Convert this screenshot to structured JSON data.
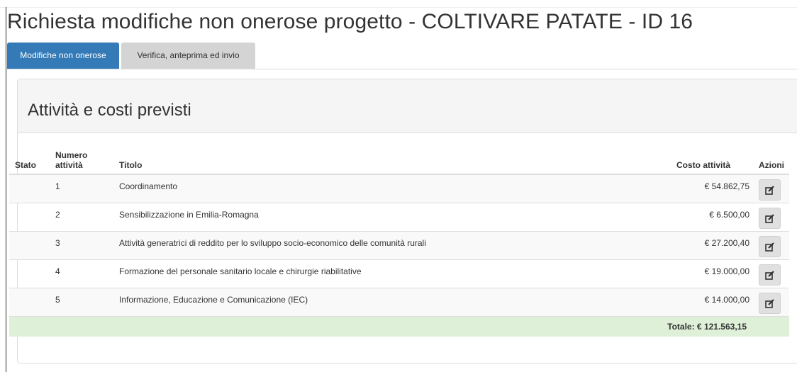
{
  "page": {
    "title": "Richiesta modifiche non onerose progetto - COLTIVARE PATATE - ID 16"
  },
  "tabs": [
    {
      "label": "Modifiche non onerose",
      "active": true
    },
    {
      "label": "Verifica, anteprima ed invio",
      "active": false
    }
  ],
  "panel": {
    "title": "Attività e costi previsti"
  },
  "table": {
    "headers": {
      "stato": "Stato",
      "numero": "Numero attività",
      "titolo": "Titolo",
      "costo": "Costo attività",
      "azioni": "Azioni"
    },
    "rows": [
      {
        "stato": "",
        "numero": "1",
        "titolo": "Coordinamento",
        "costo": "€ 54.862,75",
        "action_icon": "edit-icon"
      },
      {
        "stato": "",
        "numero": "2",
        "titolo": "Sensibilizzazione in Emilia-Romagna",
        "costo": "€ 6.500,00",
        "action_icon": "edit-icon"
      },
      {
        "stato": "",
        "numero": "3",
        "titolo": "Attività generatrici di reddito per lo sviluppo socio-economico delle comunità rurali",
        "costo": "€ 27.200,40",
        "action_icon": "edit-icon"
      },
      {
        "stato": "",
        "numero": "4",
        "titolo": "Formazione del personale sanitario locale e chirurgie riabilitative",
        "costo": "€ 19.000,00",
        "action_icon": "edit-icon"
      },
      {
        "stato": "",
        "numero": "5",
        "titolo": "Informazione, Educazione e Comunicazione (IEC)",
        "costo": "€ 14.000,00",
        "action_icon": "edit-icon"
      }
    ],
    "total": "Totale: € 121.563,15"
  },
  "colors": {
    "active_tab": "#337ab7",
    "inactive_tab": "#d4d4d4",
    "total_row": "#dff0d8",
    "panel_heading": "#f5f5f5"
  }
}
